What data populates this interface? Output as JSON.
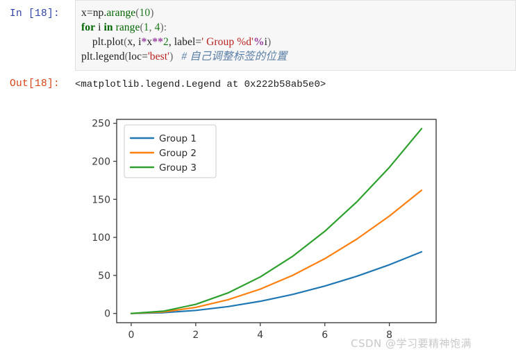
{
  "notebook": {
    "input_prompt": "In [18]:",
    "output_prompt": "Out[18]:",
    "code": {
      "line1": {
        "var": "x=np.",
        "func": "arange",
        "paren_open": "(",
        "num": "10",
        "paren_close": ")"
      },
      "line2": {
        "kw_for": "for",
        "var_i": " i ",
        "kw_in": "in",
        "func_range": " range",
        "paren_open": "(",
        "num1": "1",
        "comma": ", ",
        "num2": "4",
        "paren_close": ")",
        "colon": ":"
      },
      "line3": {
        "indent": "    ",
        "call": "plt.plot",
        "paren_open": "(",
        "args_a": "x, i",
        "op1": "*",
        "args_b": "x",
        "op2": "**",
        "num": "2",
        "args_c": ", label=",
        "str": "' Group %d'",
        "op3": "%",
        "args_d": "i",
        "paren_close": ")"
      },
      "line4": {
        "call": "plt.legend",
        "paren_open": "(",
        "arg": "loc=",
        "str": "'best'",
        "paren_close": ")",
        "spacer": "   ",
        "comment": "# 自己调整标签的位置"
      }
    },
    "output_text": "<matplotlib.legend.Legend at 0x222b58ab5e0>"
  },
  "watermark": "CSDN @学习要精神饱满",
  "chart_data": {
    "type": "line",
    "title": "",
    "xlabel": "",
    "ylabel": "",
    "x": [
      0,
      1,
      2,
      3,
      4,
      5,
      6,
      7,
      8,
      9
    ],
    "series": [
      {
        "name": "Group 1",
        "color": "#1f77b4",
        "values": [
          0,
          1,
          4,
          9,
          16,
          25,
          36,
          49,
          64,
          81
        ]
      },
      {
        "name": "Group 2",
        "color": "#ff7f0e",
        "values": [
          0,
          2,
          8,
          18,
          32,
          50,
          72,
          98,
          128,
          162
        ]
      },
      {
        "name": "Group 3",
        "color": "#2ca02c",
        "values": [
          0,
          3,
          12,
          27,
          48,
          75,
          108,
          147,
          192,
          243
        ]
      }
    ],
    "xlim": [
      -0.45,
      9.45
    ],
    "ylim": [
      -12.15,
      255.15
    ],
    "xticks": [
      0,
      2,
      4,
      6,
      8
    ],
    "xtick_labels": [
      "0",
      "2",
      "4",
      "6",
      "8"
    ],
    "yticks": [
      0,
      50,
      100,
      150,
      200,
      250
    ],
    "ytick_labels": [
      "0",
      "50",
      "100",
      "150",
      "200",
      "250"
    ],
    "grid": false,
    "legend_position": "upper left",
    "legend_entries": [
      "Group 1",
      "Group 2",
      "Group 3"
    ],
    "spine_color": "#3f3f3f",
    "background": "#ffffff"
  }
}
